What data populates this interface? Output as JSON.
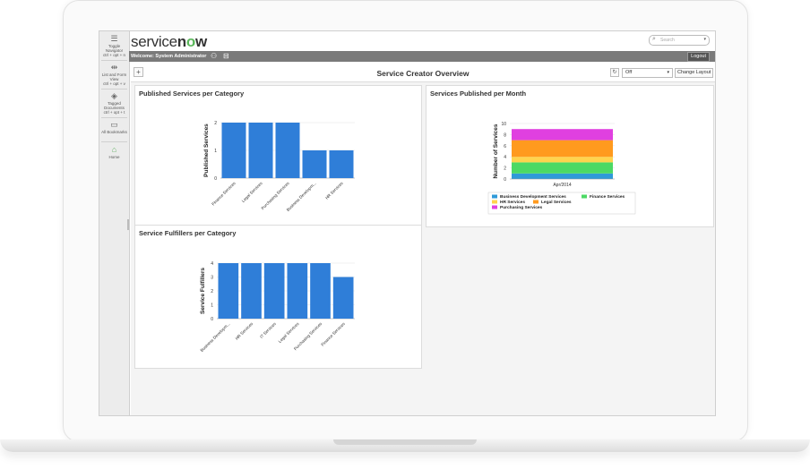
{
  "leftnav": {
    "items": [
      {
        "label": "Toggle Navigator",
        "shortcut": "ctrl + opt + n",
        "icon": "hamburger-icon"
      },
      {
        "label": "List and Form View",
        "shortcut": "ctrl + opt + v",
        "icon": "split-view-icon"
      },
      {
        "label": "Tagged Documents",
        "shortcut": "ctrl + opt + t",
        "icon": "tag-icon"
      },
      {
        "label": "All Bookmarks",
        "shortcut": "",
        "icon": "book-icon"
      },
      {
        "label": "Home",
        "shortcut": "",
        "icon": "home-icon"
      }
    ]
  },
  "header": {
    "brand_service": "service",
    "brand_n": "n",
    "brand_o": "o",
    "brand_w": "w",
    "search_placeholder": "Search",
    "welcome_label": "Welcome:",
    "user_name": "System Administrator",
    "logout_label": "Logout"
  },
  "toolbar": {
    "page_title": "Service Creator Overview",
    "refresh_value": "Off",
    "change_layout_label": "Change Layout"
  },
  "colors": {
    "bar_blue": "#2f7ed8",
    "green": "#5bb75b"
  },
  "chart_data": [
    {
      "type": "bar",
      "title": "Published Services per Category",
      "ylabel": "Published Services",
      "xlabel": "",
      "categories": [
        "Finance Services",
        "Legal Services",
        "Purchasing Services",
        "Business Developm...",
        "HR Services"
      ],
      "values": [
        2,
        2,
        2,
        1,
        1
      ],
      "ylim": [
        0,
        2
      ],
      "yticks": [
        0,
        1,
        2
      ],
      "color": "#2f7ed8"
    },
    {
      "type": "bar",
      "stacked": true,
      "title": "Services Published per Month",
      "ylabel": "Number of Services",
      "xlabel": "",
      "categories": [
        "Apr/2014"
      ],
      "ylim": [
        0,
        10
      ],
      "yticks": [
        0,
        2,
        4,
        6,
        8,
        10
      ],
      "legend_position": "bottom",
      "series": [
        {
          "name": "Business Development Services",
          "values": [
            1
          ],
          "color": "#2f9ad8"
        },
        {
          "name": "Finance Services",
          "values": [
            2
          ],
          "color": "#4cd964"
        },
        {
          "name": "HR Services",
          "values": [
            1
          ],
          "color": "#ffd34e"
        },
        {
          "name": "Legal Services",
          "values": [
            3
          ],
          "color": "#ff9a1e"
        },
        {
          "name": "Purchasing Services",
          "values": [
            2
          ],
          "color": "#e040e0"
        }
      ]
    },
    {
      "type": "bar",
      "title": "Service Fulfillers per Category",
      "ylabel": "Service Fulfillers",
      "xlabel": "",
      "categories": [
        "Business Developm...",
        "HR Services",
        "IT Services",
        "Legal Services",
        "Purchasing Services",
        "Finance Services"
      ],
      "values": [
        4,
        4,
        4,
        4,
        4,
        3
      ],
      "ylim": [
        0,
        4
      ],
      "yticks": [
        0,
        1,
        2,
        3,
        4
      ],
      "color": "#2f7ed8"
    }
  ]
}
